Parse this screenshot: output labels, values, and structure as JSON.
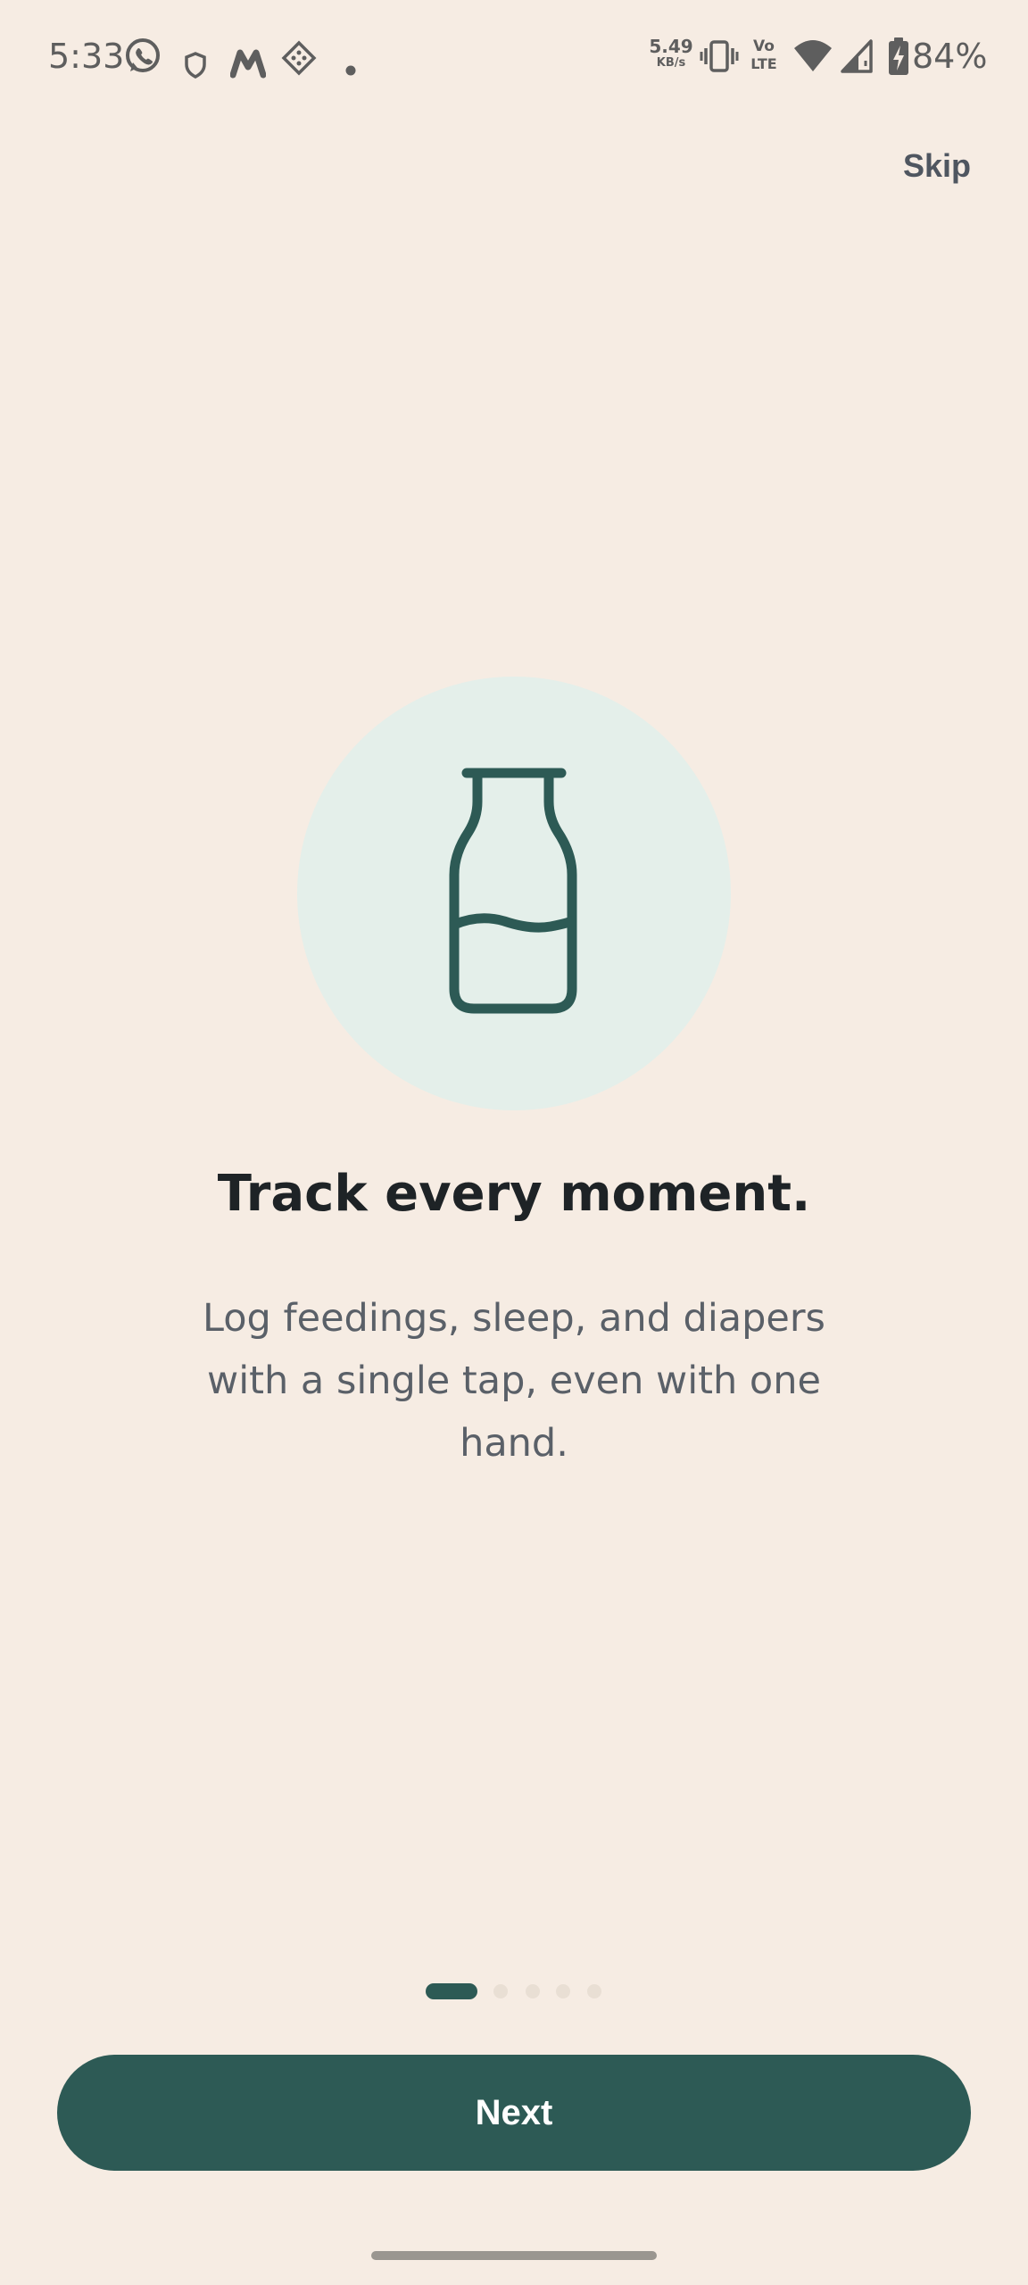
{
  "status_bar": {
    "time": "5:33",
    "net_speed_value": "5.49",
    "net_speed_unit": "KB/s",
    "volte_top": "Vo",
    "volte_bottom": "LTE",
    "battery_percent": "84%",
    "icons": [
      "whatsapp-icon",
      "shield-icon",
      "myntra-icon",
      "diamond-app-icon",
      "dot-indicator",
      "vibrate-icon",
      "volte-icon",
      "wifi-icon",
      "signal-icon",
      "battery-charging-icon"
    ]
  },
  "onboarding": {
    "skip_label": "Skip",
    "illustration_icon": "milk-bottle-icon",
    "headline": "Track every moment.",
    "subtitle": "Log feedings, sleep, and diapers with a single tap, even with one hand.",
    "pager": {
      "total": 5,
      "current": 1
    },
    "next_label": "Next"
  },
  "colors": {
    "background": "#F6ECE3",
    "accent": "#2D5A55",
    "illustration_circle": "#E4EFEA",
    "headline_text": "#1E2326",
    "body_text": "#5A6068",
    "inactive_dot": "#E9DFD4"
  }
}
